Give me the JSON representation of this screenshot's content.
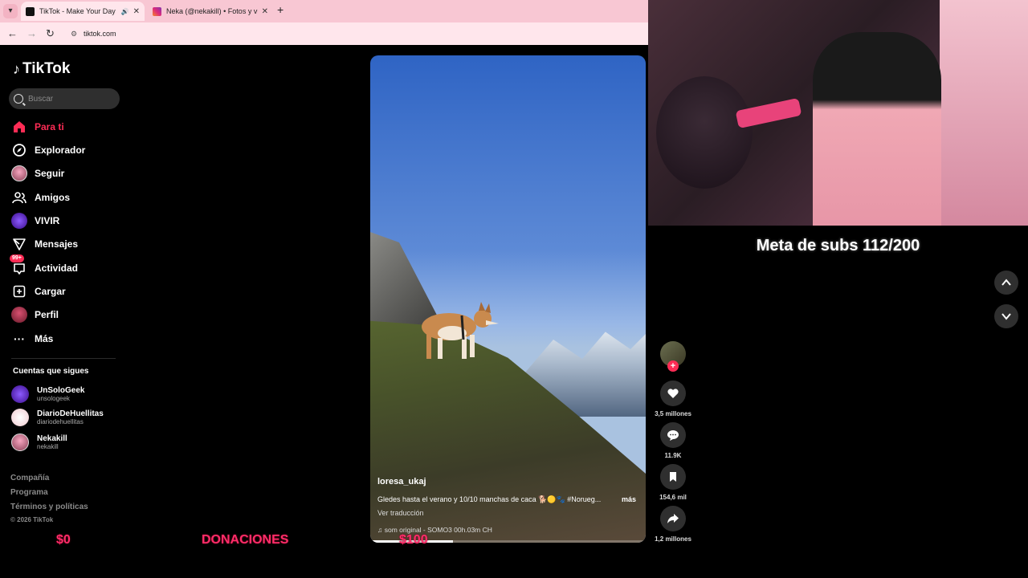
{
  "browser": {
    "tabs": [
      {
        "title": "TikTok - Make Your Day",
        "active": true
      },
      {
        "title": "Neka (@nekakill) • Fotos y vide",
        "active": false
      }
    ],
    "url": "tiktok.com"
  },
  "sidebar": {
    "logo": "TikTok",
    "search_placeholder": "Buscar",
    "nav": [
      {
        "label": "Para ti",
        "icon": "home-icon"
      },
      {
        "label": "Explorador",
        "icon": "compass-icon"
      },
      {
        "label": "Seguir",
        "icon": "avatar-icon"
      },
      {
        "label": "Amigos",
        "icon": "friends-icon"
      },
      {
        "label": "VIVIR",
        "icon": "live-icon"
      },
      {
        "label": "Mensajes",
        "icon": "send-icon"
      },
      {
        "label": "Actividad",
        "icon": "inbox-icon",
        "badge": "99+"
      },
      {
        "label": "Cargar",
        "icon": "plus-square-icon"
      },
      {
        "label": "Perfil",
        "icon": "profile-avatar-icon"
      },
      {
        "label": "Más",
        "icon": "more-icon"
      }
    ],
    "following_title": "Cuentas que sigues",
    "following": [
      {
        "name": "UnSoloGeek",
        "handle": "unsologeek"
      },
      {
        "name": "DiarioDeHuellitas",
        "handle": "diariodehuellitas"
      },
      {
        "name": "Nekakill",
        "handle": "nekakill"
      }
    ],
    "footer": [
      "Compañía",
      "Programa",
      "Términos y políticas"
    ],
    "copyright": "© 2026 TikTok"
  },
  "overlay": {
    "amount_left": "$0",
    "donations": "DONACIONES",
    "amount_right": "$100",
    "meta": "Meta de subs 112/200"
  },
  "video": {
    "username": "loresa_ukaj",
    "caption": "Gledes hasta el verano y 10/10 manchas de caca 🐕🟡🐾 #Norueg...",
    "more": "más",
    "translate": "Ver traducción",
    "sound": "♫  som original - SOMO3 00h.03m CH",
    "progress": 0.3
  },
  "actions": {
    "likes": "3,5 millones",
    "comments": "11.9K",
    "saves": "154,6 mil",
    "shares": "1,2 millones"
  }
}
